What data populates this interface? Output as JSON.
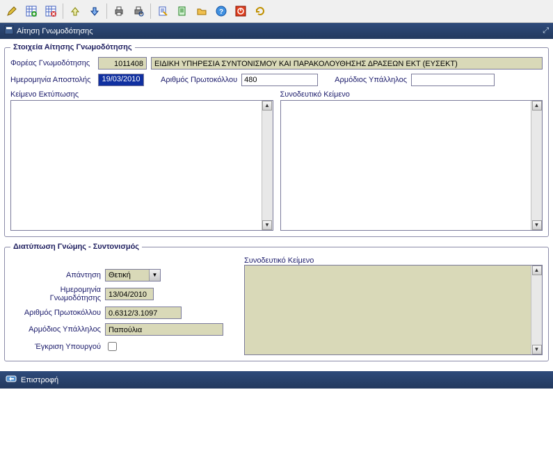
{
  "window": {
    "title": "Αίτηση Γνωμοδότησης"
  },
  "toolbar_icons": [
    "edit",
    "grid-add",
    "grid-del",
    "spacer",
    "arrow-up",
    "arrow-down",
    "spacer",
    "print",
    "print-preview",
    "spacer",
    "doc-edit",
    "doc-new",
    "folder",
    "help",
    "power",
    "refresh"
  ],
  "section1": {
    "legend": "Στοιχεία Αίτησης Γνωμοδότησης",
    "agency_label": "Φορέας Γνωμοδότησης",
    "agency_code": "1011408",
    "agency_name": "ΕΙΔΙΚΗ ΥΠΗΡΕΣΙΑ ΣΥΝΤΟΝΙΣΜΟΥ ΚΑΙ ΠΑΡΑΚΟΛΟΥΘΗΣΗΣ ΔΡΑΣΕΩΝ ΕΚΤ (ΕΥΣΕΚΤ)",
    "send_date_label": "Ημερομηνία Αποστολής",
    "send_date": "19/03/2010",
    "protocol_label": "Αριθμός Πρωτοκόλλου",
    "protocol_value": "480",
    "officer_label": "Αρμόδιος Υπάλληλος",
    "officer_value": "",
    "print_text_label": "Κείμενο Εκτύπωσης",
    "attach_text_label": "Συνοδευτικό Κείμενο",
    "print_text": "",
    "attach_text": ""
  },
  "section2": {
    "legend": "Διατύπωση Γνώμης - Συντονισμός",
    "attach_text_label": "Συνοδευτικό Κείμενο",
    "answer_label": "Απάντηση",
    "answer_value": "Θετική",
    "opinion_date_label": "Ημερομηνία Γνωμοδότησης",
    "opinion_date": "13/04/2010",
    "protocol_label": "Αριθμός Πρωτοκόλλου",
    "protocol_value": "0.6312/3.1097",
    "officer_label": "Αρμόδιος Υπάλληλος",
    "officer_value": "Παπούλια",
    "minister_label": "Έγκριση Υπουργού",
    "attach_text": ""
  },
  "footer": {
    "back_label": "Επιστροφή"
  }
}
